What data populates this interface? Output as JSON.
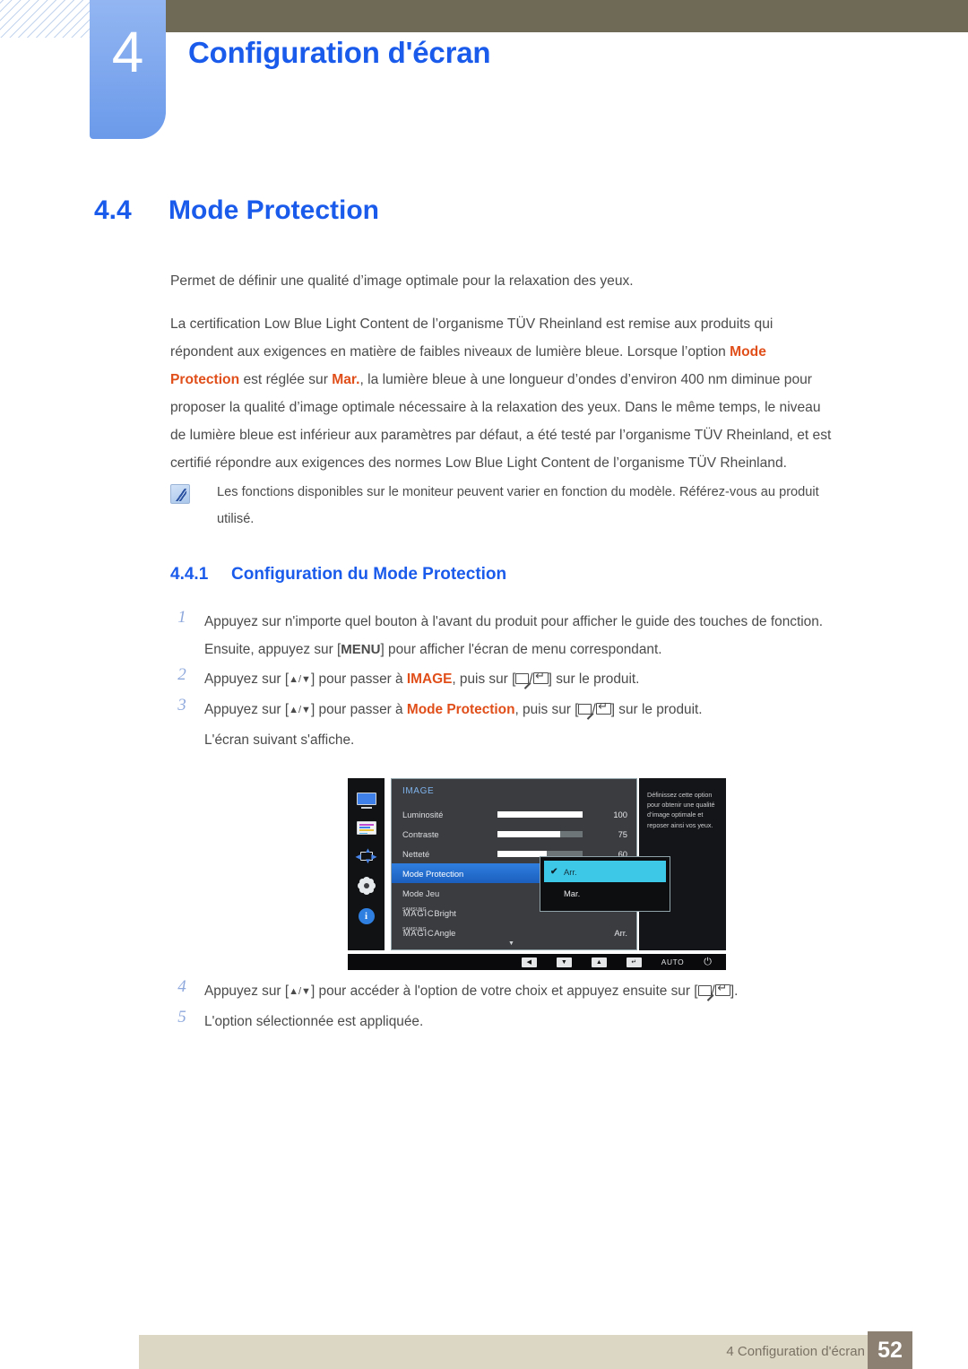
{
  "header": {
    "chapter_number": "4",
    "chapter_title": "Configuration d'écran"
  },
  "section": {
    "number": "4.4",
    "title": "Mode Protection"
  },
  "intro": {
    "paragraph1": "Permet de définir une qualité d’image optimale pour la relaxation des yeux.",
    "paragraph2_a": "La certification Low Blue Light Content de l’organisme TÜV Rheinland est remise aux produits qui répondent aux exigences en matière de faibles niveaux de lumière bleue. Lorsque l’option ",
    "kw_mode_protection": "Mode Protection",
    "paragraph2_b": " est réglée sur ",
    "kw_mar": "Mar.",
    "paragraph2_c": ", la lumière bleue à une longueur d’ondes d’environ 400 nm diminue pour proposer la qualité d’image optimale nécessaire à la relaxation des yeux. Dans le même temps, le niveau de lumière bleue est inférieur aux paramètres par défaut, a été testé par l’organisme TÜV Rheinland, et est certifié répondre aux exigences des normes Low Blue Light Content de l’organisme TÜV Rheinland."
  },
  "note": {
    "icon": "samsung-note-icon",
    "text": "Les fonctions disponibles sur le moniteur peuvent varier en fonction du modèle. Référez-vous au produit utilisé."
  },
  "subsection": {
    "number": "4.4.1",
    "title": "Configuration du Mode Protection"
  },
  "steps": {
    "n1": "1",
    "n2": "2",
    "n3": "3",
    "n4": "4",
    "n5": "5",
    "step1_a": "Appuyez sur n'importe quel bouton à l'avant du produit pour afficher le guide des touches de fonction. Ensuite, appuyez sur [",
    "step1_menu": "MENU",
    "step1_b": "] pour afficher l'écran de menu correspondant.",
    "step2_a": "Appuyez sur [",
    "step2_b": "] pour passer à ",
    "step2_kw": "IMAGE",
    "step2_c": ", puis sur [",
    "step2_d": "] sur le produit.",
    "step3_a": "Appuyez sur [",
    "step3_b": "] pour passer à ",
    "step3_kw": "Mode Protection",
    "step3_c": ", puis sur [",
    "step3_d": "] sur le produit.",
    "step3_note": "L'écran suivant s'affiche.",
    "step4_a": "Appuyez sur [",
    "step4_b": "] pour accéder à l'option de votre choix et appuyez ensuite sur [",
    "step4_c": "].",
    "step5": "L'option sélectionnée est appliquée.",
    "key_updown": "▲/▼"
  },
  "osd": {
    "menu_title": "IMAGE",
    "side_icons": [
      "monitor-icon",
      "picture-icon",
      "position-icon",
      "gear-icon",
      "info-icon"
    ],
    "rows": [
      {
        "label": "Luminosité",
        "value": "100",
        "fill_pct": 100
      },
      {
        "label": "Contraste",
        "value": "75",
        "fill_pct": 74
      },
      {
        "label": "Netteté",
        "value": "60",
        "fill_pct": 58
      }
    ],
    "selected_row": "Mode Protection",
    "row_mode_jeu": "Mode Jeu",
    "magic_sup": "SAMSUNG",
    "magic_word": "MAGIC",
    "magic_bright": "Bright",
    "magic_angle": "Angle",
    "magic_angle_value": "Arr.",
    "dropdown": {
      "selected": "Arr.",
      "options": [
        "Arr.",
        "Mar."
      ],
      "check_glyph": "✔"
    },
    "help_text": "Définissez cette option pour obtenir une qualité d’image optimale et reposer ainsi vos yeux.",
    "caret": "▼",
    "bottom_bar": {
      "btn_left": "◀",
      "btn_down": "▼",
      "btn_up": "▲",
      "btn_enter": "↵",
      "auto_label": "AUTO",
      "power_glyph": "⏻"
    }
  },
  "footer": {
    "text": "4 Configuration d'écran",
    "page": "52"
  },
  "colors": {
    "accent_blue": "#1a5beb",
    "highlight_orange": "#e04e1a",
    "header_bar": "#6e6a55",
    "tab_blue": "#6b9aea",
    "footer_bg": "#dcd6c4",
    "footer_page_bg": "#8c8073"
  }
}
